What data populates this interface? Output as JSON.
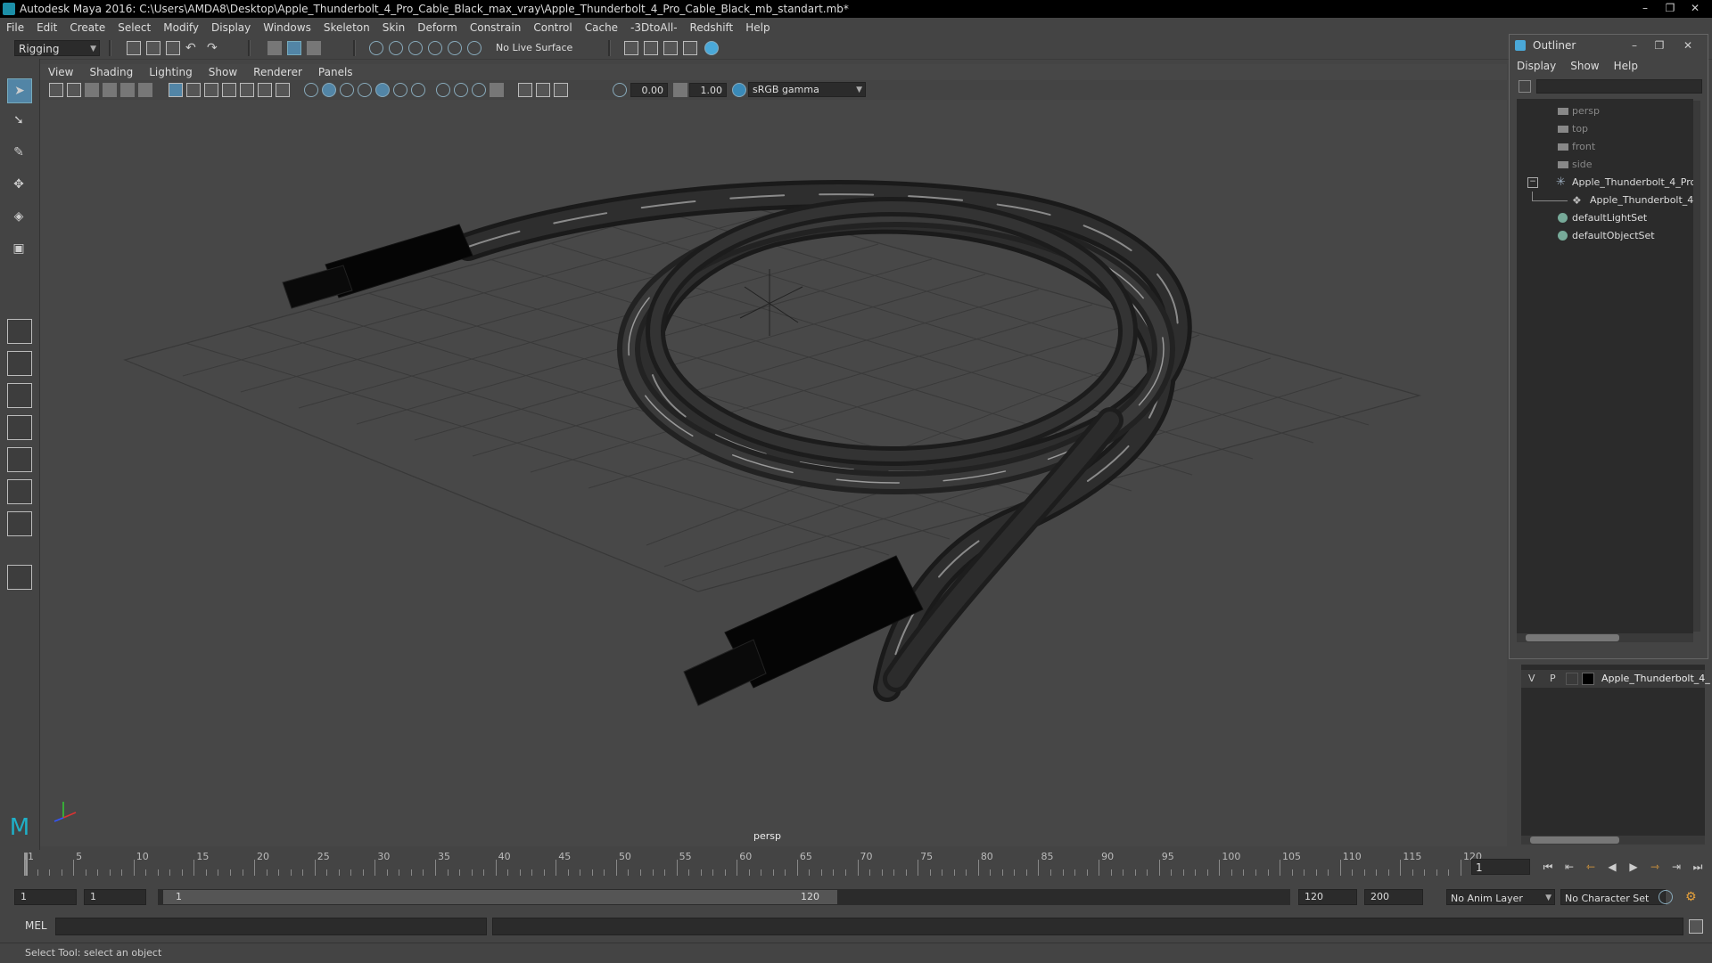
{
  "window": {
    "title": "Autodesk Maya 2016: C:\\Users\\AMDA8\\Desktop\\Apple_Thunderbolt_4_Pro_Cable_Black_max_vray\\Apple_Thunderbolt_4_Pro_Cable_Black_mb_standart.mb*",
    "buttons": [
      "–",
      "❐",
      "✕"
    ]
  },
  "menubar": [
    "File",
    "Edit",
    "Create",
    "Select",
    "Modify",
    "Display",
    "Windows",
    "Skeleton",
    "Skin",
    "Deform",
    "Constrain",
    "Control",
    "Cache",
    "-3DtoAll-",
    "Redshift",
    "Help"
  ],
  "statusline": {
    "mode": "Rigging",
    "live_surface": "No Live Surface"
  },
  "viewport": {
    "menus": [
      "View",
      "Shading",
      "Lighting",
      "Show",
      "Renderer",
      "Panels"
    ],
    "exposure": "0.00",
    "gamma": "1.00",
    "color_space": "sRGB gamma",
    "camera_label": "persp"
  },
  "outliner": {
    "title": "Outliner",
    "menus": [
      "Display",
      "Show",
      "Help"
    ],
    "items": [
      {
        "label": "persp",
        "type": "camera"
      },
      {
        "label": "top",
        "type": "camera"
      },
      {
        "label": "front",
        "type": "camera"
      },
      {
        "label": "side",
        "type": "camera"
      },
      {
        "label": "Apple_Thunderbolt_4_Pro",
        "type": "group"
      },
      {
        "label": "Apple_Thunderbolt_4_",
        "type": "mesh"
      },
      {
        "label": "defaultLightSet",
        "type": "set"
      },
      {
        "label": "defaultObjectSet",
        "type": "set"
      }
    ]
  },
  "layer_editor": {
    "v": "V",
    "p": "P",
    "layer_name": "Apple_Thunderbolt_4_"
  },
  "timeline": {
    "ticks": [
      "1",
      "5",
      "10",
      "15",
      "20",
      "25",
      "30",
      "35",
      "40",
      "45",
      "50",
      "55",
      "60",
      "65",
      "70",
      "75",
      "80",
      "85",
      "90",
      "95",
      "100",
      "105",
      "110",
      "115",
      "120"
    ],
    "current_frame": "1"
  },
  "range": {
    "start": "1",
    "playback_start": "1",
    "thumb_start": "1",
    "thumb_end": "120",
    "playback_end": "120",
    "end": "200",
    "anim_layer": "No Anim Layer",
    "character_set": "No Character Set"
  },
  "command": {
    "label": "MEL"
  },
  "helpline": "Select Tool: select an object"
}
